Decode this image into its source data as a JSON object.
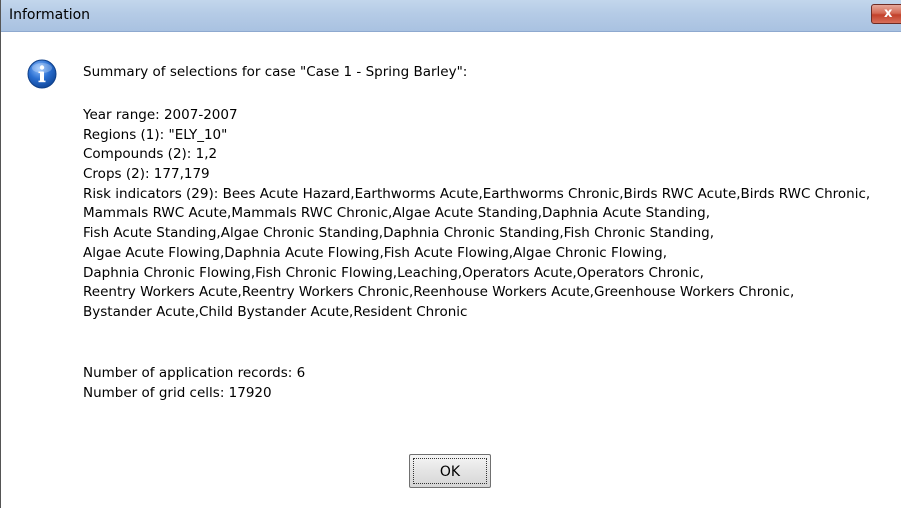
{
  "window": {
    "title": "Information",
    "close_label": "x"
  },
  "message": {
    "heading": "Summary of selections for case \"Case 1 - Spring Barley\":",
    "details": [
      "Year range: 2007-2007",
      "Regions (1): \"ELY_10\"",
      "Compounds (2): 1,2",
      "Crops (2): 177,179",
      "Risk indicators (29): Bees Acute Hazard,Earthworms Acute,Earthworms Chronic,Birds RWC Acute,Birds RWC Chronic,",
      "Mammals RWC Acute,Mammals RWC Chronic,Algae Acute Standing,Daphnia Acute Standing,",
      "Fish Acute Standing,Algae Chronic Standing,Daphnia Chronic Standing,Fish Chronic Standing,",
      "Algae Acute Flowing,Daphnia Acute Flowing,Fish Acute Flowing,Algae Chronic Flowing,",
      "Daphnia Chronic Flowing,Fish Chronic Flowing,Leaching,Operators Acute,Operators Chronic,",
      "Reentry Workers Acute,Reentry Workers Chronic,Reenhouse Workers Acute,Greenhouse Workers Chronic,",
      "Bystander Acute,Child Bystander Acute,Resident Chronic"
    ],
    "application_records": "Number of application records: 6",
    "grid_cells": "Number of grid cells: 17920"
  },
  "buttons": {
    "ok_label": "OK"
  },
  "colors": {
    "titlebar": "#b5cbe6",
    "close_button": "#c2402a",
    "info_icon": "#2a6fd1"
  },
  "icons": {
    "dialog_icon": "information-icon",
    "close_icon": "close-icon"
  }
}
